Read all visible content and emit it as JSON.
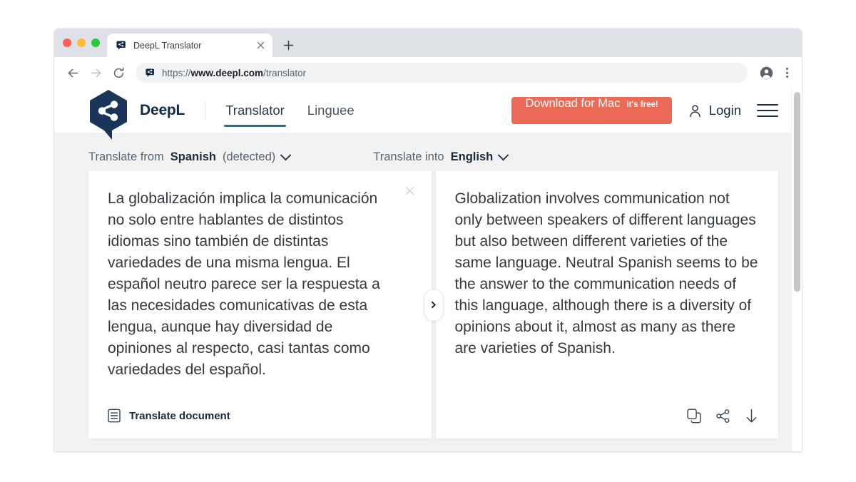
{
  "browser": {
    "tab": {
      "title": "DeepL Translator",
      "favicon_icon": "deepl-favicon",
      "close_icon": "close-icon"
    },
    "new_tab_icon": "plus-icon",
    "traffic_lights": [
      "close-red",
      "minimize-yellow",
      "maximize-green"
    ],
    "toolbar": {
      "back_icon": "arrow-left-icon",
      "forward_icon": "arrow-right-icon",
      "reload_icon": "reload-icon",
      "url_scheme": "https://",
      "url_host": "www.deepl.com",
      "url_path": "/translator",
      "site_icon": "deepl-favicon",
      "profile_icon": "account-circle-icon",
      "menu_icon": "three-dot-menu-icon"
    },
    "scrollbar_icon": "vertical-scrollbar"
  },
  "site": {
    "logo_icon": "deepl-logo-icon",
    "brand": "DeepL",
    "nav": [
      {
        "label": "Translator",
        "active": true
      },
      {
        "label": "Linguee",
        "active": false
      }
    ],
    "cta": {
      "label": "Download for Mac",
      "sublabel": "it's free!",
      "color": "#ea6a55"
    },
    "login": {
      "label": "Login",
      "icon": "person-icon"
    },
    "hamburger_icon": "hamburger-menu-icon"
  },
  "translator": {
    "source_lang": {
      "prefix": "Translate from",
      "language": "Spanish",
      "detected_note": "(detected)",
      "chevron_icon": "chevron-down-icon"
    },
    "target_lang": {
      "prefix": "Translate into",
      "language": "English",
      "chevron_icon": "chevron-down-icon"
    },
    "source_text": "La globalización implica la comunicación no solo entre hablantes de distintos idiomas sino también de distintas variedades de una misma lengua. El español neutro parece ser la respuesta a las necesidades comunicativas de esta lengua, aunque hay diversidad de opiniones al respecto, casi tantas como variedades del español.",
    "target_text": "Globalization involves communication not only between speakers of different languages but also between different varieties of the same language. Neutral Spanish seems to be the answer to the communication needs of this language, although there is a diversity of opinions about it, almost as many as there are varieties of Spanish.",
    "clear_icon": "close-icon",
    "swap_icon": "chevron-right-icon",
    "translate_document": {
      "label": "Translate document",
      "icon": "document-icon"
    },
    "target_actions": [
      {
        "name": "copy-icon"
      },
      {
        "name": "share-icon"
      },
      {
        "name": "download-icon"
      }
    ]
  },
  "colors": {
    "accent": "#256e8e",
    "brand_dark": "#0f2b46",
    "cta": "#ea6a55",
    "page_bg": "#f2f2f2"
  }
}
